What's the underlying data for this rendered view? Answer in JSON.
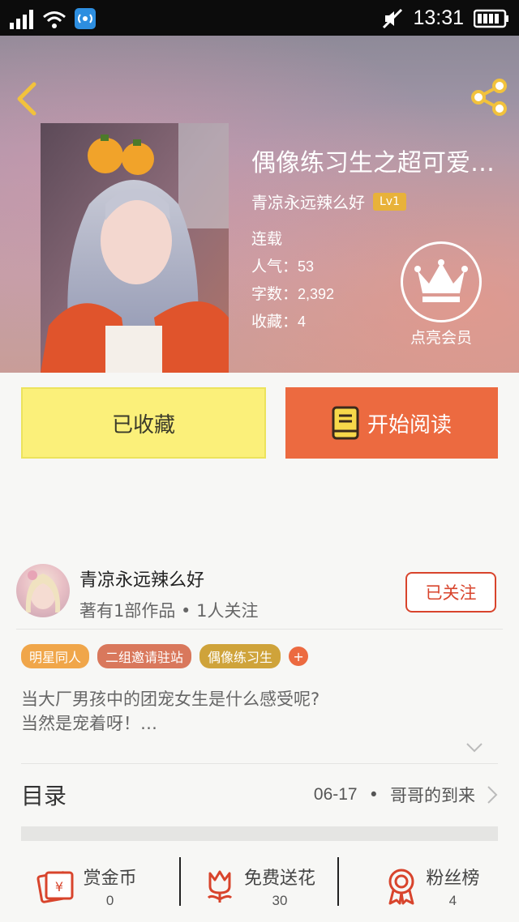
{
  "status_bar": {
    "time": "13:31"
  },
  "book": {
    "title": "偶像练习生之超可爱…",
    "author": "青凉永远辣么好",
    "level": "Lv1",
    "status": "连载",
    "popularity_label": "人气：",
    "popularity": "53",
    "words_label": "字数：",
    "words": "2,392",
    "favorites_label": "收藏：",
    "favorites": "4"
  },
  "vip": {
    "label": "点亮会员"
  },
  "actions": {
    "collected_label": "已收藏",
    "read_label": "开始阅读"
  },
  "author_card": {
    "name": "青凉永远辣么好",
    "subtitle": "著有1部作品 • 1人关注",
    "follow_label": "已关注"
  },
  "tags": [
    {
      "label": "明星同人",
      "color": "#f0a64a"
    },
    {
      "label": "二组邀请驻站",
      "color": "#d9785c"
    },
    {
      "label": "偶像练习生",
      "color": "#cfa33a"
    }
  ],
  "tag_add_label": "+",
  "description": {
    "line1": "当大厂男孩中的团宠女生是什么感受呢?",
    "line2": "当然是宠着呀！…"
  },
  "toc": {
    "title": "目录",
    "date": "06-17",
    "separator": "•",
    "latest_chapter": "哥哥的到来"
  },
  "bottom_bar": [
    {
      "label": "赏金币",
      "count": "0"
    },
    {
      "label": "免费送花",
      "count": "30"
    },
    {
      "label": "粉丝榜",
      "count": "4"
    }
  ],
  "colors": {
    "accent": "#ec6a40",
    "collected_bg": "#fbf07a",
    "follow_red": "#d8442c",
    "icon_red": "#d8442c"
  }
}
